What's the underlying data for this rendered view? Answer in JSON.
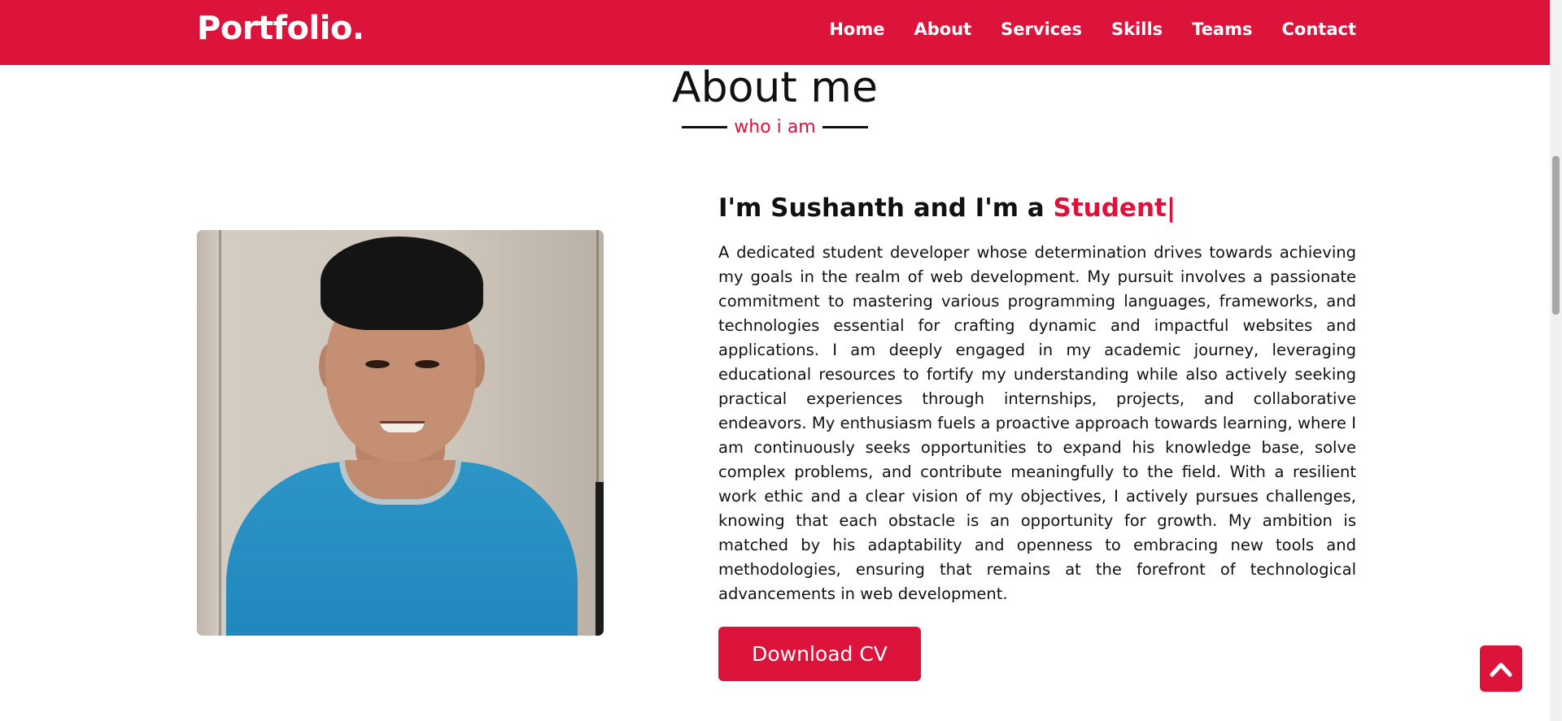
{
  "brand": {
    "logo": "Portfolio."
  },
  "nav": {
    "items": [
      {
        "label": "Home"
      },
      {
        "label": "About"
      },
      {
        "label": "Services"
      },
      {
        "label": "Skills"
      },
      {
        "label": "Teams"
      },
      {
        "label": "Contact"
      }
    ]
  },
  "about": {
    "title": "About me",
    "subtitle": "who i am",
    "intro_prefix": "I'm Sushanth and I'm a ",
    "intro_role": "Student|",
    "bio": "A dedicated student developer whose determination drives towards achieving my goals in the realm of web development. My pursuit involves a passionate commitment to mastering various programming languages, frameworks, and technologies essential for crafting dynamic and impactful websites and applications. I am deeply engaged in my academic journey, leveraging educational resources to fortify my understanding while also actively seeking practical experiences through internships, projects, and collaborative endeavors. My enthusiasm fuels a proactive approach towards learning, where I am continuously seeks opportunities to expand his knowledge base, solve complex problems, and contribute meaningfully to the field. With a resilient work ethic and a clear vision of my objectives, I actively pursues challenges, knowing that each obstacle is an opportunity for growth. My ambition is matched by his adaptability and openness to embracing new tools and methodologies, ensuring that remains at the forefront of technological advancements in web development.",
    "download_label": "Download CV"
  },
  "colors": {
    "accent": "#dc143c",
    "text": "#111111",
    "background": "#ffffff"
  },
  "icons": {
    "scroll_top": "chevron-up-icon"
  }
}
